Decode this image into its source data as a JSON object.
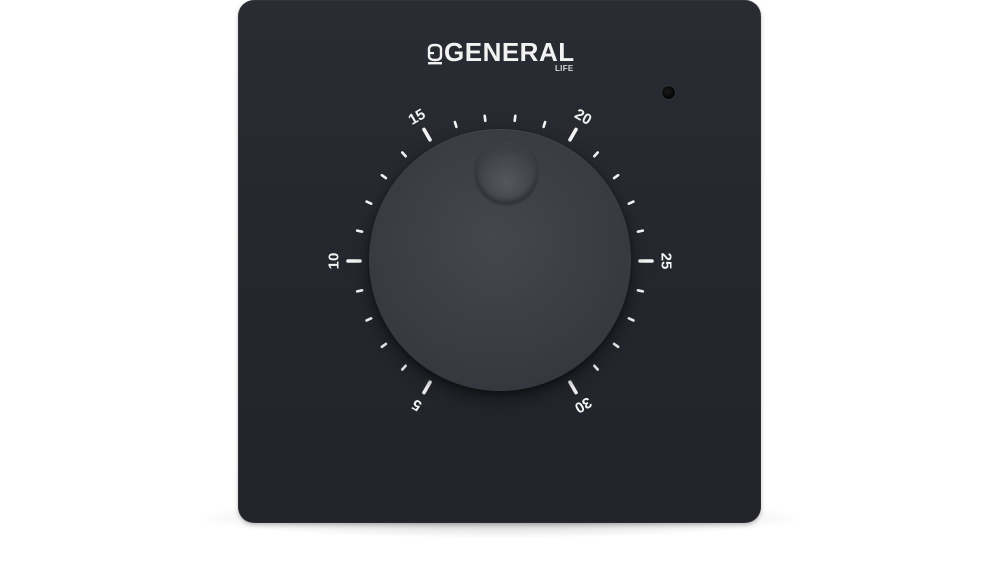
{
  "brand": {
    "name": "GENERAL",
    "sub": "LIFE"
  },
  "dial": {
    "labels": [
      "5",
      "10",
      "15",
      "20",
      "25",
      "30"
    ],
    "min": 5,
    "max": 30,
    "setting": 17.5
  },
  "colors": {
    "panel": "#25272e",
    "knob": "#3c3e46",
    "ink": "#f4f4f4",
    "led": "#050505"
  },
  "icons": {
    "brand_mark": "general-life-logo-mark",
    "indicator": "status-led"
  }
}
